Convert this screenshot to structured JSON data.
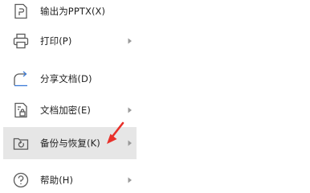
{
  "menu": {
    "items": [
      {
        "label": "输出为PPTX(X)",
        "icon": "export-pptx-icon",
        "has_submenu": false
      },
      {
        "label": "打印(P)",
        "icon": "printer-icon",
        "has_submenu": true
      },
      {
        "label": "分享文档(D)",
        "icon": "share-icon",
        "has_submenu": false
      },
      {
        "label": "文档加密(E)",
        "icon": "document-lock-icon",
        "has_submenu": true
      },
      {
        "label": "备份与恢复(K)",
        "icon": "backup-restore-icon",
        "has_submenu": true,
        "highlighted": true
      },
      {
        "label": "帮助(H)",
        "icon": "help-icon",
        "has_submenu": true
      }
    ]
  },
  "colors": {
    "highlight_bg": "#e6e6e6",
    "text": "#222222",
    "icon": "#5a5a5a",
    "share_icon_accent": "#3b7bd8",
    "annotation_arrow": "#e8302a"
  }
}
